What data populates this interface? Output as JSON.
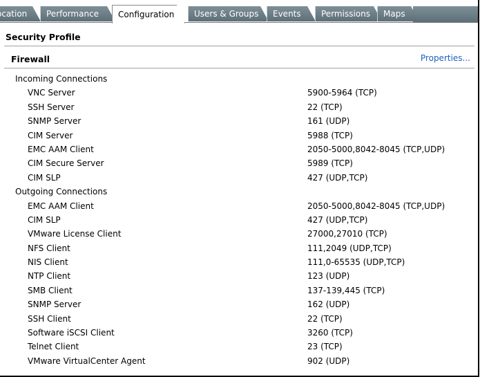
{
  "tabs": [
    {
      "label": "ocation",
      "active": false
    },
    {
      "label": "Performance",
      "active": false
    },
    {
      "label": "Configuration",
      "active": true
    },
    {
      "label": "Users & Groups",
      "active": false
    },
    {
      "label": "Events",
      "active": false
    },
    {
      "label": "Permissions",
      "active": false
    },
    {
      "label": "Maps",
      "active": false
    }
  ],
  "section_title": "Security Profile",
  "firewall": {
    "title": "Firewall",
    "properties_link": "Properties..."
  },
  "incoming": {
    "label": "Incoming Connections",
    "items": [
      {
        "name": "VNC Server",
        "value": "5900-5964 (TCP)"
      },
      {
        "name": "SSH Server",
        "value": "22 (TCP)"
      },
      {
        "name": "SNMP Server",
        "value": "161 (UDP)"
      },
      {
        "name": "CIM Server",
        "value": "5988 (TCP)"
      },
      {
        "name": "EMC AAM Client",
        "value": "2050-5000,8042-8045 (TCP,UDP)"
      },
      {
        "name": "CIM Secure Server",
        "value": "5989 (TCP)"
      },
      {
        "name": "CIM SLP",
        "value": "427 (UDP,TCP)"
      }
    ]
  },
  "outgoing": {
    "label": "Outgoing Connections",
    "items": [
      {
        "name": "EMC AAM Client",
        "value": "2050-5000,8042-8045 (TCP,UDP)"
      },
      {
        "name": "CIM SLP",
        "value": "427 (UDP,TCP)"
      },
      {
        "name": "VMware License Client",
        "value": "27000,27010 (TCP)"
      },
      {
        "name": "NFS Client",
        "value": "111,2049 (UDP,TCP)"
      },
      {
        "name": "NIS Client",
        "value": "111,0-65535 (UDP,TCP)"
      },
      {
        "name": "NTP Client",
        "value": "123 (UDP)"
      },
      {
        "name": "SMB Client",
        "value": "137-139,445 (TCP)"
      },
      {
        "name": "SNMP Server",
        "value": "162 (UDP)"
      },
      {
        "name": "SSH Client",
        "value": "22 (TCP)"
      },
      {
        "name": "Software iSCSI Client",
        "value": "3260 (TCP)"
      },
      {
        "name": "Telnet Client",
        "value": "23 (TCP)"
      },
      {
        "name": "VMware VirtualCenter Agent",
        "value": "902 (UDP)"
      }
    ]
  }
}
